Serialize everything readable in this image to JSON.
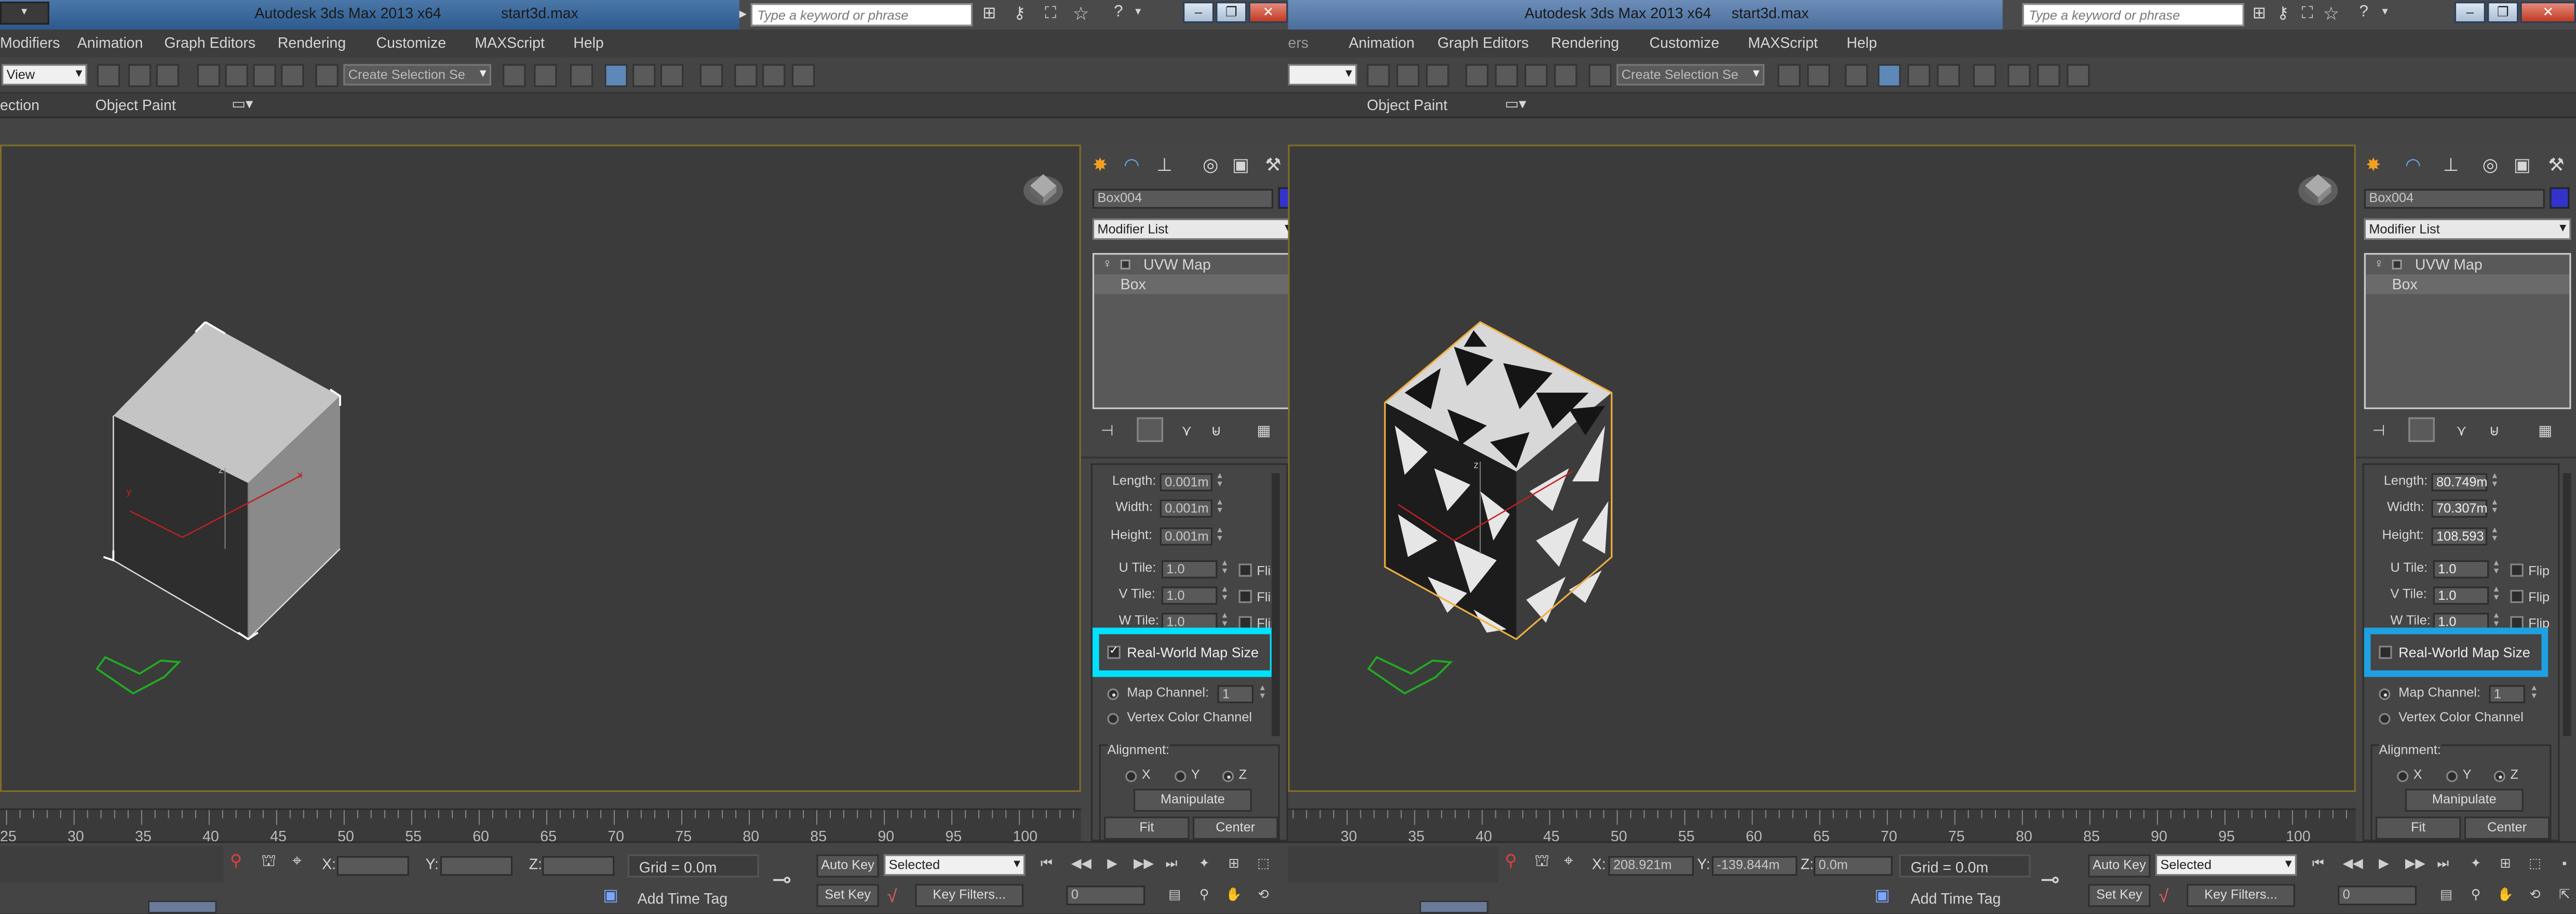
{
  "left": {
    "title": {
      "app": "Autodesk 3ds Max  2013 x64",
      "file": "start3d.max"
    },
    "search": {
      "placeholder": "Type a keyword or phrase"
    },
    "menu": [
      "Modifiers",
      "Animation",
      "Graph Editors",
      "Rendering",
      "Customize",
      "MAXScript",
      "Help"
    ],
    "toolbar": {
      "view_value": "View",
      "selection_set_placeholder": "Create Selection Se"
    },
    "ribbon": {
      "left_label": "ection",
      "object_paint": "Object Paint"
    },
    "command_panel": {
      "object_name": "Box004",
      "object_color": "#3333cc",
      "modifier_list": "Modifier List",
      "stack": [
        "UVW Map",
        "Box"
      ],
      "params": {
        "length_label": "Length:",
        "length": "0.001m",
        "width_label": "Width:",
        "width": "0.001m",
        "height_label": "Height:",
        "height": "0.001m",
        "utile_label": "U Tile:",
        "utile": "1.0",
        "vtile_label": "V Tile:",
        "vtile": "1.0",
        "wtile_label": "W Tile:",
        "wtile": "1.0",
        "flip_label": "Flip",
        "real_world_label": "Real-World Map Size",
        "real_world_checked": true,
        "map_channel_label": "Map Channel:",
        "map_channel": "1",
        "vertex_color_label": "Vertex Color Channel",
        "alignment_label": "Alignment:",
        "x_label": "X",
        "y_label": "Y",
        "z_label": "Z",
        "manipulate": "Manipulate",
        "fit": "Fit",
        "center": "Center"
      }
    },
    "timeline_ticks": [
      "25",
      "30",
      "35",
      "40",
      "45",
      "50",
      "55",
      "60",
      "65",
      "70",
      "75",
      "80",
      "85",
      "90",
      "95",
      "100"
    ],
    "status": {
      "x_label": "X:",
      "x_value": "",
      "y_label": "Y:",
      "y_value": "",
      "z_label": "Z:",
      "z_value": "",
      "grid": "Grid = 0.0m",
      "add_time_tag": "Add Time Tag",
      "auto_key": "Auto Key",
      "auto_key_value": "Selected",
      "set_key": "Set Key",
      "key_filters": "Key Filters...",
      "frame": "0"
    }
  },
  "right": {
    "title": {
      "app": "Autodesk 3ds Max  2013 x64",
      "file": "start3d.max"
    },
    "search": {
      "placeholder": "Type a keyword or phrase"
    },
    "menu": [
      "ers",
      "Animation",
      "Graph Editors",
      "Rendering",
      "Customize",
      "MAXScript",
      "Help"
    ],
    "toolbar": {
      "selection_set_placeholder": "Create Selection Se"
    },
    "ribbon": {
      "object_paint": "Object Paint"
    },
    "command_panel": {
      "object_name": "Box004",
      "object_color": "#3333cc",
      "modifier_list": "Modifier List",
      "stack": [
        "UVW Map",
        "Box"
      ],
      "params": {
        "length_label": "Length:",
        "length": "80.749m",
        "width_label": "Width:",
        "width": "70.307m",
        "height_label": "Height:",
        "height": "108.593",
        "utile_label": "U Tile:",
        "utile": "1.0",
        "vtile_label": "V Tile:",
        "vtile": "1.0",
        "wtile_label": "W Tile:",
        "wtile": "1.0",
        "flip_label": "Flip",
        "real_world_label": "Real-World Map Size",
        "real_world_checked": false,
        "map_channel_label": "Map Channel:",
        "map_channel": "1",
        "vertex_color_label": "Vertex Color Channel",
        "alignment_label": "Alignment:",
        "x_label": "X",
        "y_label": "Y",
        "z_label": "Z",
        "manipulate": "Manipulate",
        "fit": "Fit",
        "center": "Center"
      }
    },
    "timeline_ticks": [
      "30",
      "35",
      "40",
      "45",
      "50",
      "55",
      "60",
      "65",
      "70",
      "75",
      "80",
      "85",
      "90",
      "95",
      "100"
    ],
    "status": {
      "x_label": "X:",
      "x_value": "208.921m",
      "y_label": "Y:",
      "y_value": "-139.844m",
      "z_label": "Z:",
      "z_value": "0.0m",
      "grid": "Grid = 0.0m",
      "add_time_tag": "Add Time Tag",
      "auto_key": "Auto Key",
      "auto_key_value": "Selected",
      "set_key": "Set Key",
      "key_filters": "Key Filters...",
      "frame": "0"
    }
  },
  "colors": {
    "highlight": "#00e0ff",
    "viewport_border": "#7f6d2a",
    "selection_outline": "#f0b040"
  }
}
